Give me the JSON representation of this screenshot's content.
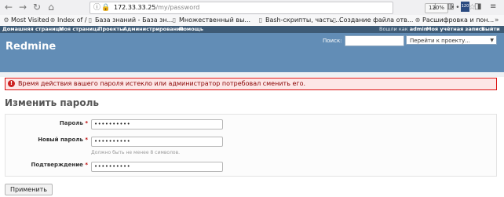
{
  "browser": {
    "url_host": "172.33.33.25",
    "url_path": "/my/password",
    "zoom": "120%",
    "badge": "120"
  },
  "bookmarks": [
    {
      "label": "Most Visited",
      "icon": "gear-icon"
    },
    {
      "label": "Index of /",
      "icon": "globe-icon"
    },
    {
      "label": "База знаний - База зн...",
      "icon": "page-icon"
    },
    {
      "label": "Множественный вы...",
      "icon": "page-icon"
    },
    {
      "label": "Bash-скрипты, часть ...",
      "icon": "page-icon"
    },
    {
      "label": "Создание файла отв...",
      "icon": "page-icon"
    },
    {
      "label": "Расшифровка и пон...",
      "icon": "globe-icon"
    }
  ],
  "top_menu": {
    "items": [
      "Домашняя страница",
      "Моя страница",
      "Проекты",
      "Администрирование",
      "Помощь"
    ],
    "logged_in_prefix": "Вошли как",
    "user": "admin",
    "my_account": "Моя учётная запись",
    "logout": "Выйти"
  },
  "header": {
    "title": "Redmine",
    "search_label": "Поиск:",
    "project_select": "Перейти к проекту..."
  },
  "flash": {
    "error": "Время действия вашего пароля истекло или администратор потребовал сменить его."
  },
  "page": {
    "title": "Изменить пароль"
  },
  "form": {
    "fields": [
      {
        "label": "Пароль",
        "required": "*",
        "value": "••••••••••"
      },
      {
        "label": "Новый пароль",
        "required": "*",
        "value": "••••••••••"
      },
      {
        "label": "Подтверждение",
        "required": "*",
        "value": "••••••••••"
      }
    ],
    "hint": "Должно быть не менее 8 символов.",
    "submit": "Применить"
  }
}
